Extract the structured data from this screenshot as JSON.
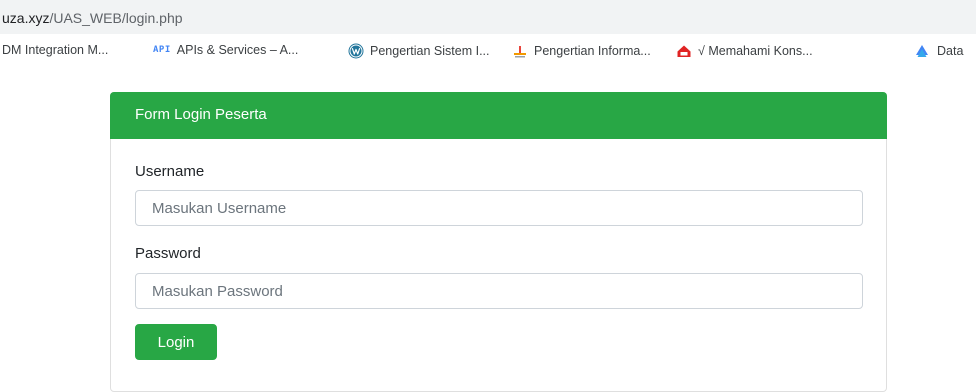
{
  "browser": {
    "url_host": "uza.xyz",
    "url_path": "/UAS_WEB/login.php"
  },
  "bookmarks": [
    {
      "label": "DM Integration M...",
      "icon": "none"
    },
    {
      "label": "APIs & Services – A...",
      "icon": "api-badge-icon",
      "badge": "API"
    },
    {
      "label": "Pengertian Sistem I...",
      "icon": "wordpress-icon"
    },
    {
      "label": "Pengertian Informa...",
      "icon": "site-logo-icon"
    },
    {
      "label": "√ Memahami Kons...",
      "icon": "house-icon"
    },
    {
      "label": "Data",
      "icon": "cloud-icon"
    }
  ],
  "form": {
    "title": "Form Login Peserta",
    "username_label": "Username",
    "username_placeholder": "Masukan Username",
    "password_label": "Password",
    "password_placeholder": "Masukan Password",
    "login_label": "Login"
  },
  "colors": {
    "accent": "#28a745",
    "url_bar_bg": "#f1f3f4"
  }
}
